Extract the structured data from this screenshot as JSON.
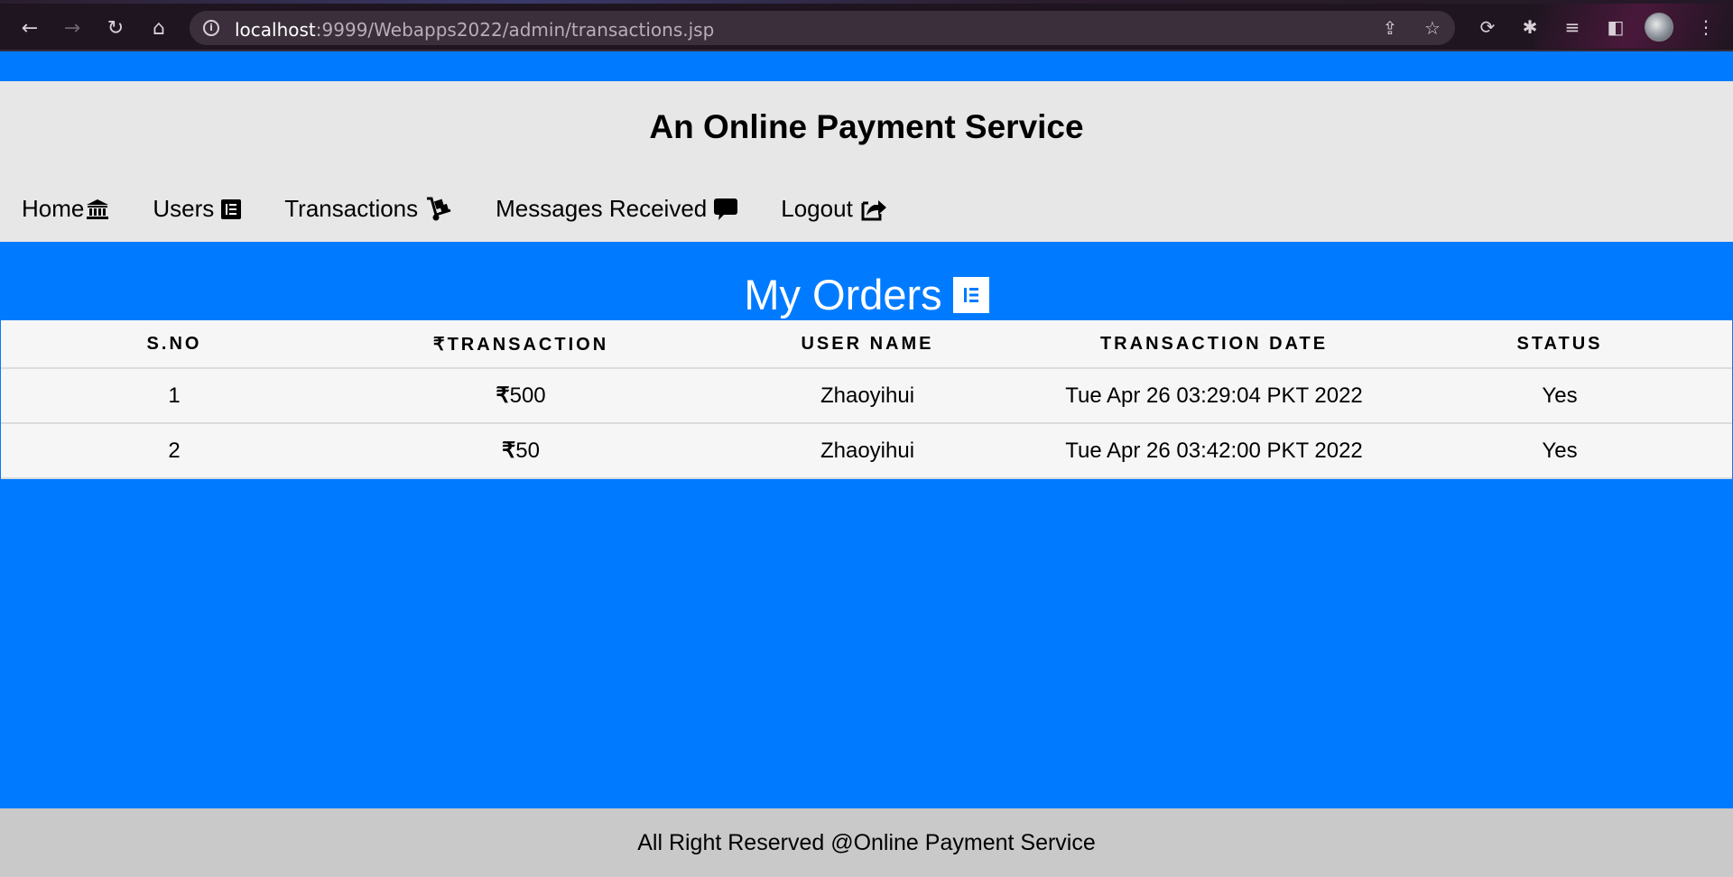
{
  "browser": {
    "url_host": "localhost",
    "url_path": ":9999/Webapps2022/admin/transactions.jsp"
  },
  "site": {
    "title": "An Online Payment Service"
  },
  "menu": {
    "items": [
      {
        "label": "Home",
        "icon": "bank-icon"
      },
      {
        "label": "Users",
        "icon": "list-icon"
      },
      {
        "label": "Transactions",
        "icon": "hand-truck-icon"
      },
      {
        "label": "Messages Received",
        "icon": "speech-bubble-icon"
      },
      {
        "label": "Logout",
        "icon": "share-out-icon"
      }
    ]
  },
  "orders": {
    "title": "My Orders",
    "columns": [
      "S.NO",
      "₹TRANSACTION",
      "USER NAME",
      "TRANSACTION DATE",
      "STATUS"
    ],
    "rows": [
      {
        "sno": "1",
        "amount": "500",
        "user": "Zhaoyihui",
        "date": "Tue Apr 26 03:29:04 PKT 2022",
        "status": "Yes"
      },
      {
        "sno": "2",
        "amount": "50",
        "user": "Zhaoyihui",
        "date": "Tue Apr 26 03:42:00 PKT 2022",
        "status": "Yes"
      }
    ],
    "currency_symbol": "₹"
  },
  "footer": {
    "text": "All Right Reserved @Online Payment Service"
  },
  "colors": {
    "primary": "#007bff",
    "header_bg": "#e7e7e7",
    "footer_bg": "#c9c9c9"
  }
}
